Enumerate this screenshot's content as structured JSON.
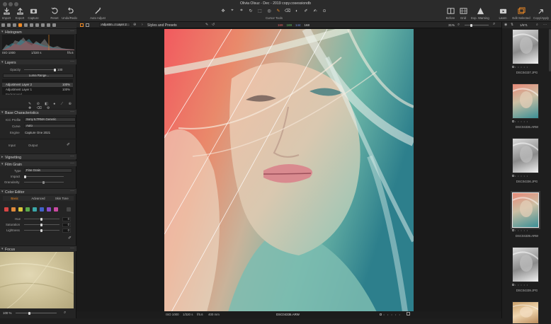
{
  "window": {
    "title": "Olivia Olsuz - Dec - 2019 copy.cosessiondb"
  },
  "toolbar": {
    "left_buttons": [
      "Import",
      "Export",
      "Capture",
      "Reset",
      "Undo/Redo",
      "Auto Adjust"
    ],
    "cursor_tools_label": "Cursor Tools",
    "right_buttons": [
      "Before",
      "Grid",
      "Exp. Warning",
      "Learn",
      "Edit Selected",
      "Copy/Apply"
    ]
  },
  "histogram": {
    "title": "Histogram",
    "iso": "ISO 1000",
    "shutter": "1/320 s",
    "aperture": "f/5.6"
  },
  "layers": {
    "title": "Layers",
    "opacity_label": "Opacity",
    "opacity_value": "100",
    "luma_range_label": "Luma Range...",
    "items": [
      {
        "name": "Adjustment Layer 2",
        "value": "100%"
      },
      {
        "name": "Adjustment Layer 1",
        "value": "100%"
      },
      {
        "name": "Background",
        "value": ""
      }
    ]
  },
  "base": {
    "title": "Base Characteristics",
    "icc_label": "ICC Profile",
    "icc_value": "Sony ILTRMA Generic",
    "curve_label": "Curve",
    "curve_value": "Auto",
    "engine_label": "Engine",
    "engine_value": "Capture One 2021",
    "input_label": "Input",
    "output_label": "Output"
  },
  "vignetting": {
    "title": "Vignetting"
  },
  "film_grain": {
    "title": "Film Grain",
    "type_label": "Type",
    "type_value": "Fine Grain",
    "impact_label": "Impact",
    "granularity_label": "Granularity"
  },
  "color_editor": {
    "title": "Color Editor",
    "tabs": [
      "Basic",
      "Advanced",
      "Skin Tone"
    ],
    "hue_label": "Hue",
    "hue_value": "0",
    "saturation_label": "Saturation",
    "saturation_value": "0",
    "lightness_label": "Lightness",
    "lightness_value": "0",
    "swatches": [
      "#d64545",
      "#e08a3a",
      "#d9c43b",
      "#5aa84a",
      "#3aa7a8",
      "#4062c9",
      "#8a4cc9",
      "#c94aa0"
    ]
  },
  "focus": {
    "title": "Focus",
    "zoom": "100 %"
  },
  "viewer": {
    "layer_select": "Adjustm...t Layer 2",
    "preset_title": "Styles and Presets",
    "readout": [
      "169",
      "169",
      "144",
      "168"
    ],
    "zoom": "31%",
    "footer_iso": "ISO 1000",
    "footer_shutter": "1/320 s",
    "footer_aperture": "f/5.6",
    "footer_focal": "400 mm",
    "footer_file": "DSC04336.ARW"
  },
  "browser": {
    "counter": "1/671",
    "thumbs": [
      {
        "file": "DSC04337.JPG",
        "variant": "bw"
      },
      {
        "file": "DSC04336.ARW",
        "variant": "color"
      },
      {
        "file": "DSC04336.JPG",
        "variant": "bw"
      },
      {
        "file": "DSC04339.ARW",
        "variant": "color-selected"
      },
      {
        "file": "DSC04339.JPG",
        "variant": "bw"
      },
      {
        "file": "",
        "variant": "warm"
      }
    ]
  }
}
